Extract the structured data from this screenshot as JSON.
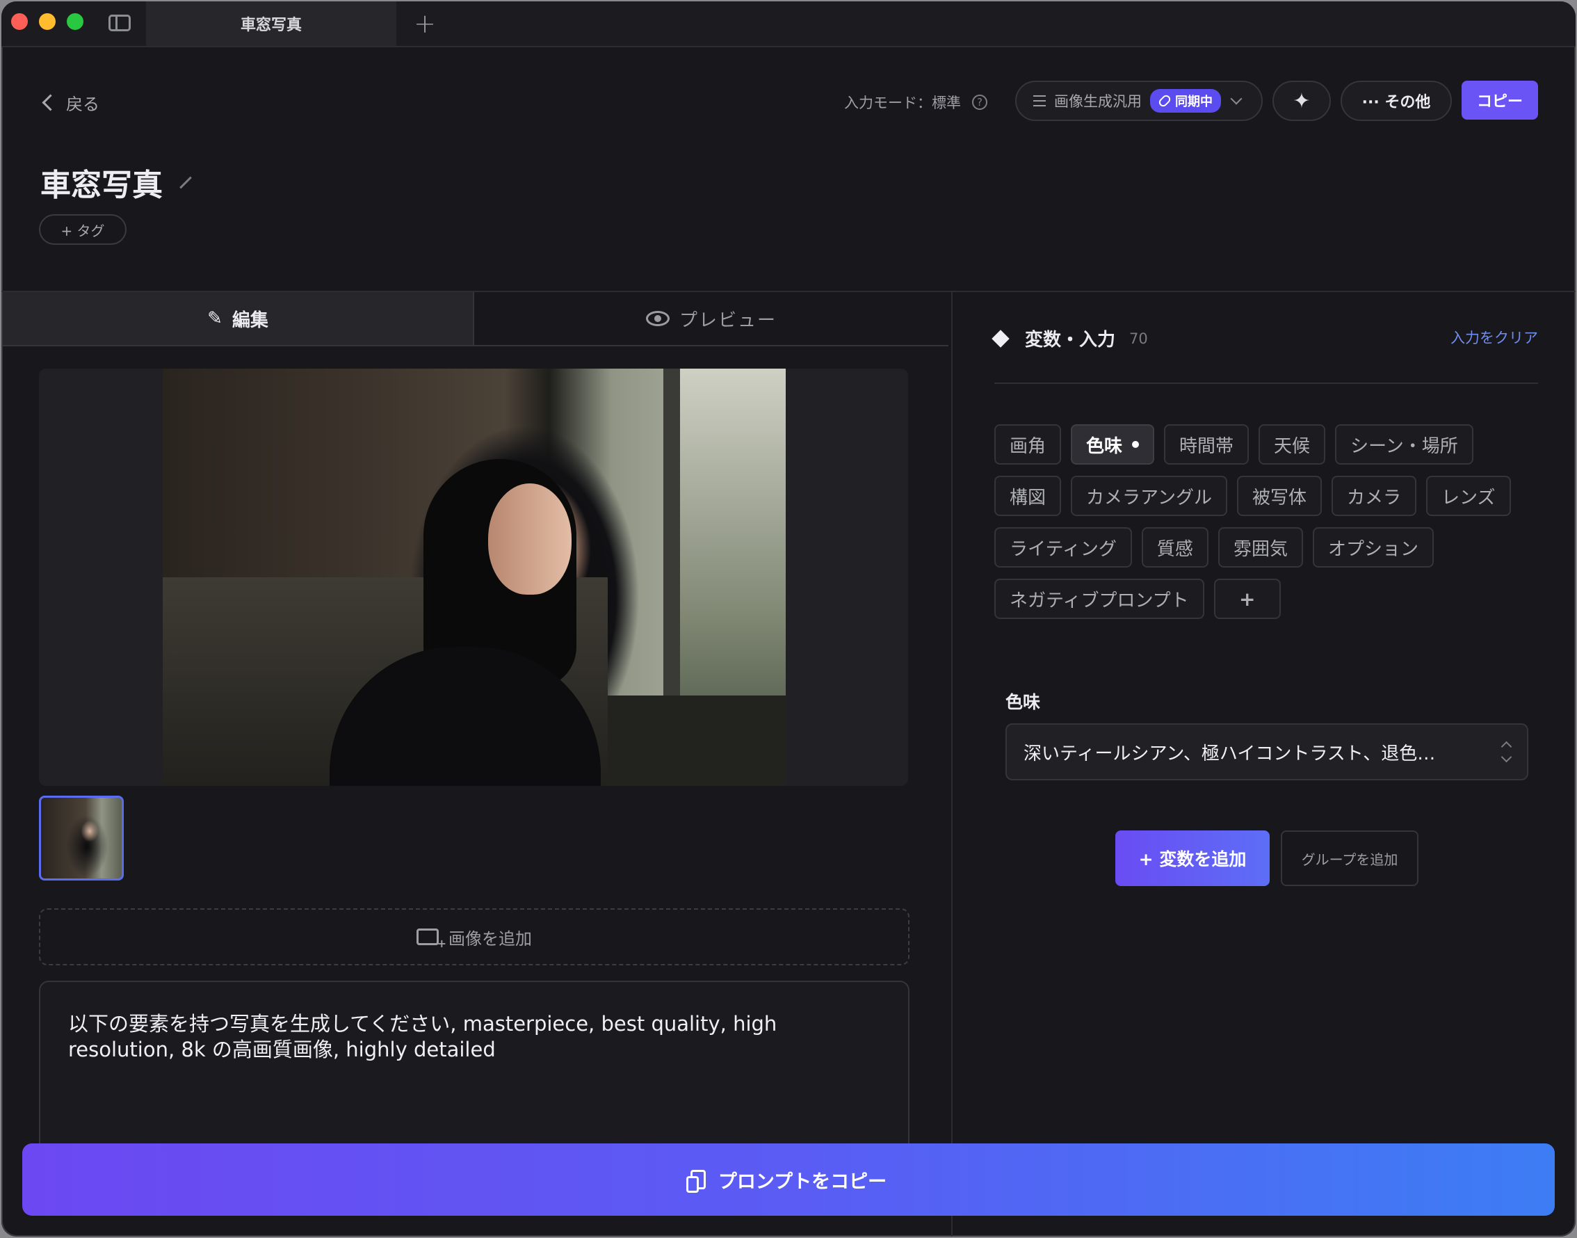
{
  "titlebar": {
    "tab_title": "車窓写真",
    "new_tab_symbol": "+"
  },
  "header": {
    "back_label": "戻る",
    "input_mode": "入力モード：標準",
    "help_symbol": "?",
    "preset_label": "画像生成汎用",
    "sync_badge": "同期中",
    "sparkle_symbol": "✦",
    "more_label": "··· その他",
    "copy_label": "コピー"
  },
  "document": {
    "title": "車窓写真",
    "add_tag_label": "+ タグ"
  },
  "editor_tabs": {
    "edit_label": "編集",
    "preview_label": "プレビュー"
  },
  "editor": {
    "add_image_label": "画像を追加",
    "prompt_text": "以下の要素を持つ写真を生成してください, masterpiece, best quality, high resolution, 8k の高画質画像, highly detailed"
  },
  "variables": {
    "header_label": "変数・入力",
    "count": "70",
    "clear_label": "入力をクリア",
    "chips_rows": [
      [
        "画角",
        "色味",
        "時間帯",
        "天候",
        "シーン・場所"
      ],
      [
        "構図",
        "カメラアングル",
        "被写体",
        "カメラ",
        "レンズ"
      ],
      [
        "ライティング",
        "質感",
        "雰囲気",
        "オプション"
      ],
      [
        "ネガティブプロンプト"
      ]
    ],
    "active_chip": "色味",
    "add_chip_symbol": "+",
    "field_label": "色味",
    "field_value": "深いティールシアン、極ハイコントラスト、退色…",
    "add_variable_label": "+ 変数を追加",
    "add_group_label": "グループを追加"
  },
  "footer": {
    "copy_prompt_label": "プロンプトをコピー"
  },
  "colors": {
    "accent": "#6a54f5",
    "link": "#6f8cf0",
    "background": "#18181c"
  }
}
